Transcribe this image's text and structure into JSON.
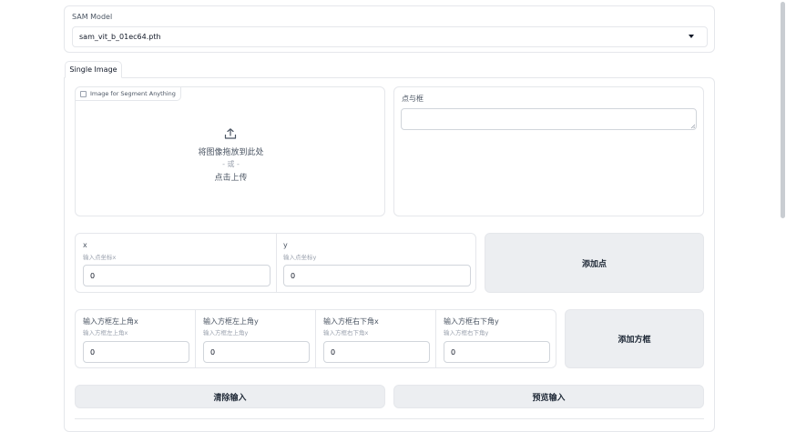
{
  "model": {
    "label": "SAM Model",
    "selected": "sam_vit_b_01ec64.pth"
  },
  "tabs": [
    {
      "label": "Single Image",
      "active": true
    }
  ],
  "image_upload": {
    "badge": "Image for Segment Anything",
    "drop_text": "将图像拖放到此处",
    "or_text": "- 或 -",
    "click_text": "点击上传"
  },
  "points_boxes": {
    "label": "点与框",
    "value": ""
  },
  "point_inputs": {
    "x": {
      "label": "x",
      "hint": "输入点坐标x",
      "value": "0"
    },
    "y": {
      "label": "y",
      "hint": "输入点坐标y",
      "value": "0"
    },
    "add_button": "添加点"
  },
  "box_inputs": {
    "fields": [
      {
        "label": "输入方框左上角x",
        "hint": "输入方框左上角x",
        "value": "0"
      },
      {
        "label": "输入方框左上角y",
        "hint": "输入方框左上角y",
        "value": "0"
      },
      {
        "label": "输入方框右下角x",
        "hint": "输入方框右下角x",
        "value": "0"
      },
      {
        "label": "输入方框右下角y",
        "hint": "输入方框右下角y",
        "value": "0"
      }
    ],
    "add_button": "添加方框"
  },
  "actions": {
    "clear": "清除输入",
    "preview": "预览输入"
  },
  "colors": {
    "border": "#e5e7eb",
    "button_bg": "#eceef1",
    "text": "#374151"
  }
}
